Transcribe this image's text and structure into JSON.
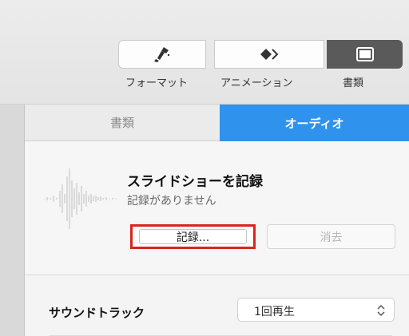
{
  "toolbar": {
    "buttons": [
      {
        "label": "フォーマット",
        "icon": "paintbrush-icon"
      },
      {
        "label": "アニメーション",
        "icon": "diamond-animation-icon"
      },
      {
        "label": "書類",
        "icon": "document-icon",
        "selected": true
      }
    ]
  },
  "tabs": [
    {
      "label": "書類",
      "active": false
    },
    {
      "label": "オーディオ",
      "active": true
    }
  ],
  "record": {
    "title": "スライドショーを記録",
    "subtitle": "記録がありません",
    "record_label": "記録...",
    "clear_label": "消去"
  },
  "soundtrack": {
    "label": "サウンドトラック",
    "selected_option": "1回再生"
  },
  "colors": {
    "accent": "#2f93ee",
    "highlight_border": "#d8261c"
  }
}
